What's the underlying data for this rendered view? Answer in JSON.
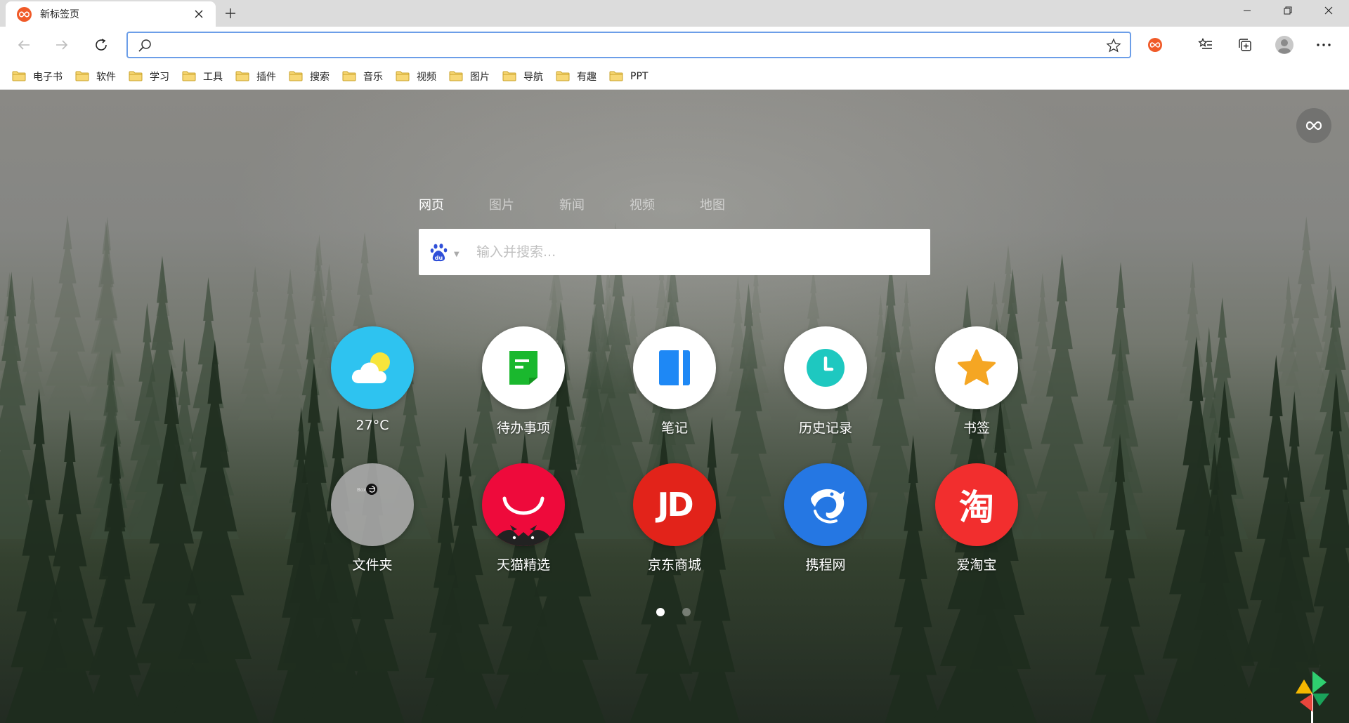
{
  "window": {
    "tab_title": "新标签页",
    "controls": {
      "minimize": "minimize-icon",
      "maximize": "restore-icon",
      "close": "close-icon"
    }
  },
  "toolbar": {
    "address_value": "",
    "icons": [
      "back-icon",
      "forward-icon",
      "reload-icon",
      "search-icon",
      "favorite-star-icon",
      "extension-infinity-icon",
      "favorites-list-icon",
      "collections-icon",
      "profile-avatar-icon",
      "more-menu-icon"
    ]
  },
  "bookmarks": [
    {
      "label": "电子书"
    },
    {
      "label": "软件"
    },
    {
      "label": "学习"
    },
    {
      "label": "工具"
    },
    {
      "label": "插件"
    },
    {
      "label": "搜索"
    },
    {
      "label": "音乐"
    },
    {
      "label": "视频"
    },
    {
      "label": "图片"
    },
    {
      "label": "导航"
    },
    {
      "label": "有趣"
    },
    {
      "label": "PPT"
    }
  ],
  "search": {
    "tabs": [
      {
        "label": "网页",
        "active": true
      },
      {
        "label": "图片",
        "active": false
      },
      {
        "label": "新闻",
        "active": false
      },
      {
        "label": "视频",
        "active": false
      },
      {
        "label": "地图",
        "active": false
      }
    ],
    "engine_icon": "baidu-paw-icon",
    "placeholder": "输入并搜索..."
  },
  "tiles": [
    {
      "label": "27°C",
      "icon": "weather-cloud-sun-icon",
      "color": "#2ec3f0"
    },
    {
      "label": "待办事项",
      "icon": "todo-note-icon",
      "color": "#1ab82e"
    },
    {
      "label": "笔记",
      "icon": "notes-book-icon",
      "color": "#1e88f5"
    },
    {
      "label": "历史记录",
      "icon": "history-clock-icon",
      "color": "#1ec8c0"
    },
    {
      "label": "书签",
      "icon": "bookmark-star-icon",
      "color": "#f5a623"
    },
    {
      "label": "文件夹",
      "icon": "folder-apps-icon",
      "color": "#a8a8a8"
    },
    {
      "label": "天猫精选",
      "icon": "tmall-icon",
      "color": "#ee0a3b"
    },
    {
      "label": "京东商城",
      "icon": "jd-icon",
      "color": "#e2231a"
    },
    {
      "label": "携程网",
      "icon": "ctrip-dolphin-icon",
      "color": "#2577e3"
    },
    {
      "label": "爱淘宝",
      "icon": "taobao-icon",
      "color": "#f22e2e"
    }
  ],
  "jd_text": "JD",
  "taobao_text": "淘",
  "pagination": {
    "total": 2,
    "current": 1
  }
}
